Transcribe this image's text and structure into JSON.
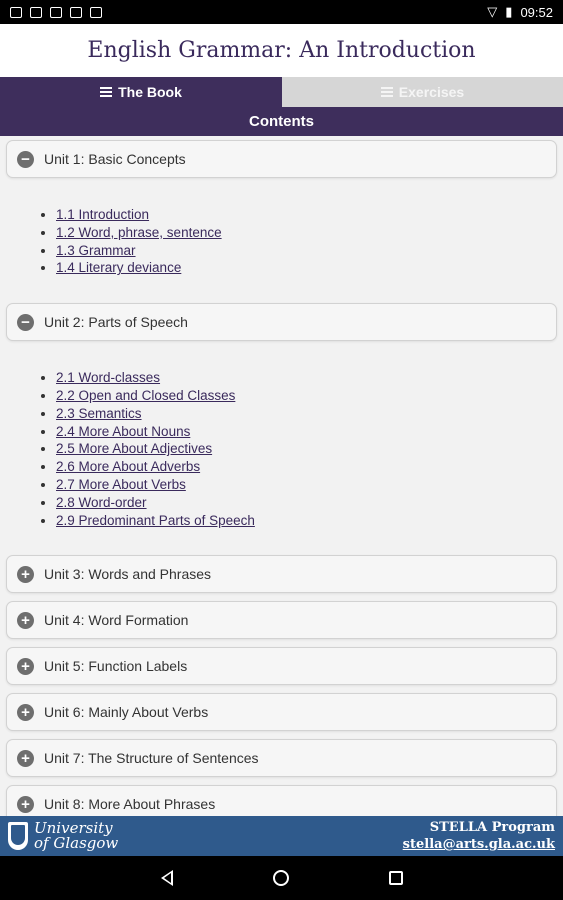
{
  "status_bar": {
    "left_icons": [
      "image-icon",
      "signal-icon",
      "mail-icon",
      "android-icon",
      "photos-icon"
    ],
    "right_icons": [
      "wifi-icon",
      "battery-icon"
    ],
    "time": "09:52"
  },
  "header": {
    "title": "English Grammar: An Introduction"
  },
  "tabs": [
    {
      "label": "The Book",
      "icon": "list-icon",
      "active": true
    },
    {
      "label": "Exercises",
      "icon": "list-icon",
      "active": false
    }
  ],
  "contents_label": "Contents",
  "units": [
    {
      "title": "Unit 1: Basic Concepts",
      "expanded": true,
      "toggle": "−",
      "items": [
        "1.1 Introduction",
        "1.2 Word, phrase, sentence",
        "1.3 Grammar",
        "1.4 Literary deviance"
      ]
    },
    {
      "title": "Unit 2: Parts of Speech",
      "expanded": true,
      "toggle": "−",
      "items": [
        "2.1 Word-classes",
        "2.2 Open and Closed Classes",
        "2.3 Semantics",
        "2.4 More About Nouns",
        "2.5 More About Adjectives",
        "2.6 More About Adverbs",
        "2.7 More About Verbs",
        "2.8 Word-order",
        "2.9 Predominant Parts of Speech"
      ]
    },
    {
      "title": "Unit 3: Words and Phrases",
      "expanded": false,
      "toggle": "+"
    },
    {
      "title": "Unit 4: Word Formation",
      "expanded": false,
      "toggle": "+"
    },
    {
      "title": "Unit 5: Function Labels",
      "expanded": false,
      "toggle": "+"
    },
    {
      "title": "Unit 6: Mainly About Verbs",
      "expanded": false,
      "toggle": "+"
    },
    {
      "title": "Unit 7: The Structure of Sentences",
      "expanded": false,
      "toggle": "+"
    },
    {
      "title": "Unit 8: More About Phrases",
      "expanded": false,
      "toggle": "+"
    }
  ],
  "footer": {
    "university_line1": "University",
    "university_line2": "of Glasgow",
    "program": "STELLA Program",
    "email": "stella@arts.gla.ac.uk"
  },
  "colors": {
    "primary": "#3e2e5c",
    "footer_blue": "#2f5a8c",
    "inactive_tab": "#d6d6d6"
  }
}
